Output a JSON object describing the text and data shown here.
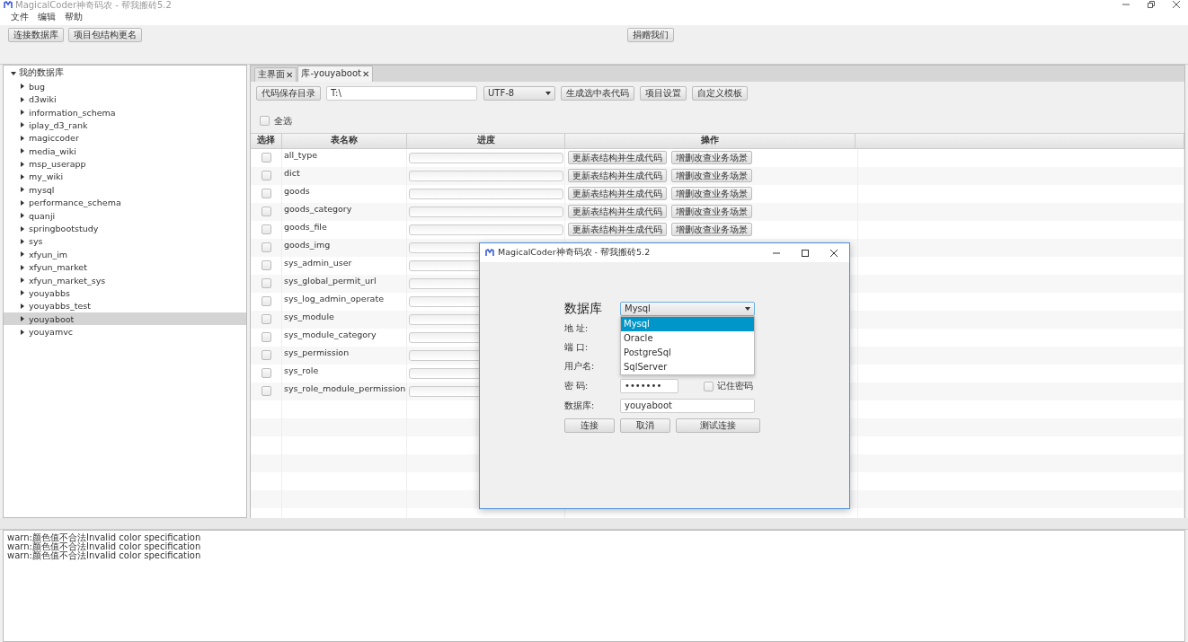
{
  "window": {
    "title": "MagicalCoder神奇码农 - 帮我搬砖5.2"
  },
  "menu": [
    "文件",
    "编辑",
    "帮助"
  ],
  "toolbar": {
    "left_buttons": [
      "连接数据库",
      "项目包结构更名"
    ],
    "center_button": "捐赠我们"
  },
  "tree": {
    "label": "我的数据库",
    "expanded": true,
    "children": [
      {
        "label": "bug",
        "selected": false
      },
      {
        "label": "d3wiki",
        "selected": false
      },
      {
        "label": "information_schema",
        "selected": false
      },
      {
        "label": "iplay_d3_rank",
        "selected": false
      },
      {
        "label": "magiccoder",
        "selected": false
      },
      {
        "label": "media_wiki",
        "selected": false
      },
      {
        "label": "msp_userapp",
        "selected": false
      },
      {
        "label": "my_wiki",
        "selected": false
      },
      {
        "label": "mysql",
        "selected": false
      },
      {
        "label": "performance_schema",
        "selected": false
      },
      {
        "label": "quanji",
        "selected": false
      },
      {
        "label": "springbootstudy",
        "selected": false
      },
      {
        "label": "sys",
        "selected": false
      },
      {
        "label": "xfyun_im",
        "selected": false
      },
      {
        "label": "xfyun_market",
        "selected": false
      },
      {
        "label": "xfyun_market_sys",
        "selected": false
      },
      {
        "label": "youyabbs",
        "selected": false
      },
      {
        "label": "youyabbs_test",
        "selected": false
      },
      {
        "label": "youyaboot",
        "selected": true
      },
      {
        "label": "youyamvc",
        "selected": false
      }
    ]
  },
  "tabs": [
    {
      "label": "主界面",
      "close": "✕",
      "selected": false
    },
    {
      "label": "库-youyaboot",
      "close": "✕",
      "selected": true
    }
  ],
  "code_toolbar": {
    "save_dir_button": "代码保存目录",
    "save_dir_value": "T:\\",
    "encoding": "UTF-8",
    "buttons": [
      "生成选中表代码",
      "项目设置",
      "自定义模板"
    ]
  },
  "select_all": {
    "label": "全选",
    "checked": false
  },
  "table": {
    "columns": [
      "选择",
      "表名称",
      "进度",
      "操作"
    ],
    "rows": [
      {
        "checked": false,
        "level": 0,
        "name": "all_type",
        "actions": [
          "更新表结构并生成代码",
          "增删改查业务场景"
        ]
      },
      {
        "checked": false,
        "level": 0,
        "name": "dict",
        "actions": [
          "更新表结构并生成代码",
          "增删改查业务场景"
        ]
      },
      {
        "checked": false,
        "level": 0,
        "name": "goods",
        "actions": [
          "更新表结构并生成代码",
          "增删改查业务场景"
        ]
      },
      {
        "checked": false,
        "level": 0,
        "name": "goods_category",
        "actions": [
          "更新表结构并生成代码",
          "增删改查业务场景"
        ]
      },
      {
        "checked": false,
        "level": 0,
        "name": "goods_file",
        "actions": [
          "更新表结构并生成代码",
          "增删改查业务场景"
        ]
      },
      {
        "checked": false,
        "level": 0,
        "name": "goods_img"
      },
      {
        "checked": false,
        "level": 0,
        "name": "sys_admin_user"
      },
      {
        "checked": false,
        "level": 0,
        "name": "sys_global_permit_url"
      },
      {
        "checked": false,
        "level": 0,
        "name": "sys_log_admin_operate"
      },
      {
        "checked": false,
        "level": 0,
        "name": "sys_module"
      },
      {
        "checked": false,
        "level": 0,
        "name": "sys_module_category"
      },
      {
        "checked": false,
        "level": 0,
        "name": "sys_permission"
      },
      {
        "checked": false,
        "level": 0,
        "name": "sys_role"
      },
      {
        "checked": false,
        "level": 0,
        "name": "sys_role_module_permission"
      }
    ]
  },
  "log": [
    "warn:颜色值不合法Invalid color specification",
    "warn:颜色值不合法Invalid color specification",
    "warn:颜色值不合法Invalid color specification"
  ],
  "dialog": {
    "title": "MagicalCoder神奇码农 - 帮我搬砖5.2",
    "db_label": "数据库",
    "db_type": "Mysql",
    "db_options": [
      {
        "label": "Mysql",
        "selected": true
      },
      {
        "label": "Oracle",
        "selected": false
      },
      {
        "label": "PostgreSql",
        "selected": false
      },
      {
        "label": "SqlServer",
        "selected": false
      }
    ],
    "labels": [
      "地 址:",
      "端 口:",
      "用户名:",
      "密 码:",
      "数据库:"
    ],
    "password": "•••••••",
    "remember": {
      "label": "记住密码",
      "checked": false
    },
    "database": "youyaboot",
    "buttons": [
      "连接",
      "取消",
      "测试连接"
    ]
  }
}
